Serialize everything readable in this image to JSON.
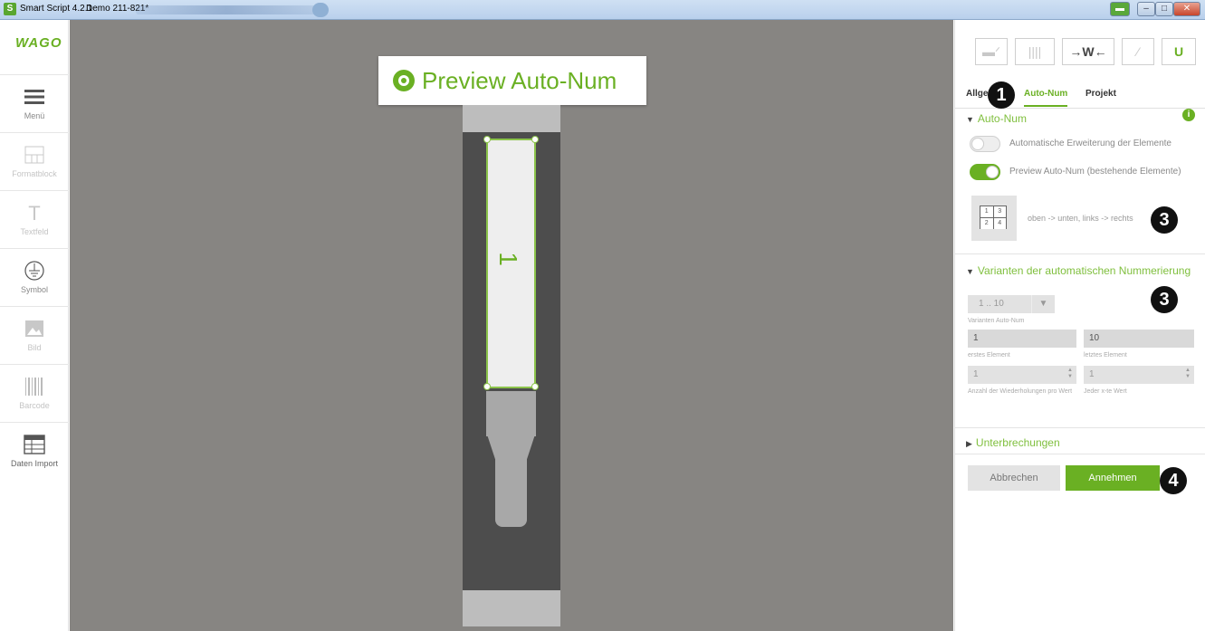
{
  "window": {
    "app_title": "Smart Script 4.2.1",
    "document": "Demo 211-821*",
    "app_icon": "S",
    "accent_color": "#6ab023"
  },
  "left_toolbar": {
    "logo": "WAGO",
    "items": [
      {
        "label": "Menü",
        "icon": "menu-icon",
        "enabled": true
      },
      {
        "label": "Formatblock",
        "icon": "formatblock-icon",
        "enabled": false
      },
      {
        "label": "Textfeld",
        "icon": "textfield-icon",
        "enabled": false
      },
      {
        "label": "Symbol",
        "icon": "ground-symbol-icon",
        "enabled": true
      },
      {
        "label": "Bild",
        "icon": "image-icon",
        "enabled": false
      },
      {
        "label": "Barcode",
        "icon": "barcode-icon",
        "enabled": false
      },
      {
        "label": "Daten Import",
        "icon": "table-icon",
        "enabled": true
      }
    ]
  },
  "canvas": {
    "banner": "Preview Auto-Num",
    "marker_number": "1"
  },
  "right_panel": {
    "toolbar": {
      "lock": "‒‒",
      "columns": "||||",
      "width": "→W←",
      "wand": "⁄",
      "magnet": "U"
    },
    "tabs": [
      {
        "label": "Allge",
        "selected": false
      },
      {
        "label": "Auto-Num",
        "selected": true
      },
      {
        "label": "Projekt",
        "selected": false
      }
    ],
    "badges": {
      "b1": "1",
      "b3a": "3",
      "b3b": "3",
      "b4": "4"
    },
    "autonum": {
      "header": "Auto-Num",
      "info": "i",
      "toggle1_label": "Automatische Erweiterung der Elemente",
      "toggle1_on": false,
      "toggle2_label": "Preview Auto-Num (bestehende Elemente)",
      "toggle2_on": true,
      "order_cells": [
        "1",
        "3",
        "2",
        "4"
      ],
      "order_label": "oben -> unten, links -> rechts"
    },
    "varianten": {
      "header": "Varianten der automatischen Nummerierung",
      "dropdown_value": "1 .. 10",
      "dropdown_label": "Varianten Auto-Num",
      "first_value": "1",
      "first_label": "erstes Element",
      "last_value": "10",
      "last_label": "letztes Element",
      "repeat_value": "1",
      "repeat_label": "Anzahl der Wiederholungen pro Wert",
      "every_value": "1",
      "every_label": "Jeder x-te Wert"
    },
    "unterbrechungen": {
      "header": "Unterbrechungen"
    },
    "buttons": {
      "cancel": "Abbrechen",
      "accept": "Annehmen"
    }
  }
}
